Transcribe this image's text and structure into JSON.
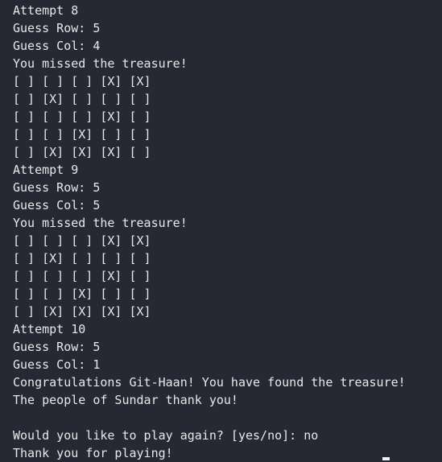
{
  "terminal": {
    "lines": [
      "Attempt 8",
      "Guess Row: 5",
      "Guess Col: 4",
      "You missed the treasure!",
      "[ ] [ ] [ ] [X] [X]",
      "[ ] [X] [ ] [ ] [ ]",
      "[ ] [ ] [ ] [X] [ ]",
      "[ ] [ ] [X] [ ] [ ]",
      "[ ] [X] [X] [X] [ ]",
      "Attempt 9",
      "Guess Row: 5",
      "Guess Col: 5",
      "You missed the treasure!",
      "[ ] [ ] [ ] [X] [X]",
      "[ ] [X] [ ] [ ] [ ]",
      "[ ] [ ] [ ] [X] [ ]",
      "[ ] [ ] [X] [ ] [ ]",
      "[ ] [X] [X] [X] [X]",
      "Attempt 10",
      "Guess Row: 5",
      "Guess Col: 1",
      "Congratulations Git-Haan! You have found the treasure!",
      "The people of Sundar thank you!",
      "",
      "Would you like to play again? [yes/no]: no",
      "Thank you for playing!"
    ]
  }
}
